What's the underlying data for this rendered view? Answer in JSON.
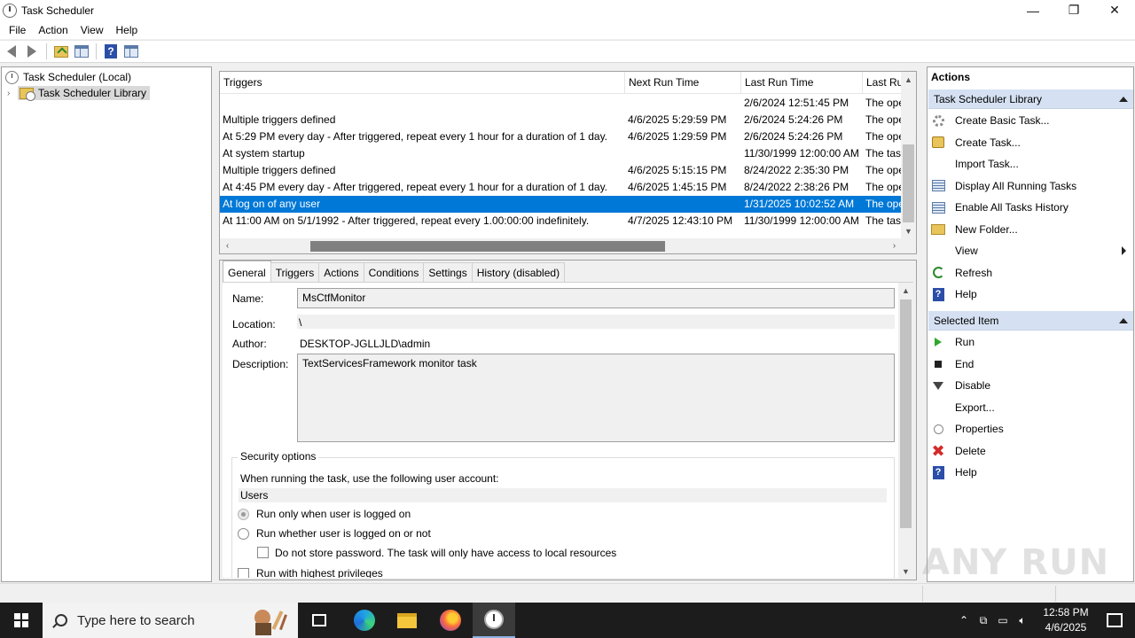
{
  "window": {
    "title": "Task Scheduler",
    "controls": {
      "minimize": "—",
      "restore": "❐",
      "close": "✕"
    }
  },
  "menubar": [
    "File",
    "Action",
    "View",
    "Help"
  ],
  "toolbar": {
    "icons": [
      "back-icon",
      "forward-icon",
      "up-folder-icon",
      "show-hide-console-tree-icon",
      "help-icon",
      "show-hide-action-pane-icon"
    ]
  },
  "tree": {
    "root": "Task Scheduler (Local)",
    "library": "Task Scheduler Library"
  },
  "task_list": {
    "columns": [
      "Triggers",
      "Next Run Time",
      "Last Run Time",
      "Last Ru"
    ],
    "rows": [
      {
        "trigger": "",
        "next": "",
        "last": "2/6/2024 12:51:45 PM",
        "result": "The ope"
      },
      {
        "trigger": "Multiple triggers defined",
        "next": "4/6/2025 5:29:59 PM",
        "last": "2/6/2024 5:24:26 PM",
        "result": "The ope"
      },
      {
        "trigger": "At 5:29 PM every day - After triggered, repeat every 1 hour for a duration of 1 day.",
        "next": "4/6/2025 1:29:59 PM",
        "last": "2/6/2024 5:24:26 PM",
        "result": "The ope"
      },
      {
        "trigger": "At system startup",
        "next": "",
        "last": "11/30/1999 12:00:00 AM",
        "result": "The tas"
      },
      {
        "trigger": "Multiple triggers defined",
        "next": "4/6/2025 5:15:15 PM",
        "last": "8/24/2022 2:35:30 PM",
        "result": "The ope"
      },
      {
        "trigger": "At 4:45 PM every day - After triggered, repeat every 1 hour for a duration of 1 day.",
        "next": "4/6/2025 1:45:15 PM",
        "last": "8/24/2022 2:38:26 PM",
        "result": "The ope"
      },
      {
        "trigger": "At log on of any user",
        "next": "",
        "last": "1/31/2025 10:02:52 AM",
        "result": "The ope",
        "selected": true
      },
      {
        "trigger": "At 11:00 AM on 5/1/1992 - After triggered, repeat every 1.00:00:00 indefinitely.",
        "next": "4/7/2025 12:43:10 PM",
        "last": "11/30/1999 12:00:00 AM",
        "result": "The tas"
      }
    ]
  },
  "details": {
    "tabs": [
      "General",
      "Triggers",
      "Actions",
      "Conditions",
      "Settings",
      "History (disabled)"
    ],
    "active_tab": "General",
    "labels": {
      "name": "Name:",
      "location": "Location:",
      "author": "Author:",
      "description": "Description:"
    },
    "values": {
      "name": "MsCtfMonitor",
      "location": "\\",
      "author": "DESKTOP-JGLLJLD\\admin",
      "description": "TextServicesFramework monitor task"
    },
    "security": {
      "title": "Security options",
      "account_prompt": "When running the task, use the following user account:",
      "account": "Users",
      "radio_logged_on": "Run only when user is logged on",
      "radio_whether": "Run whether user is logged on or not",
      "checkbox_no_store": "Do not store password.  The task will only have access to local resources",
      "checkbox_highest": "Run with highest privileges"
    }
  },
  "actions": {
    "title": "Actions",
    "library_section": "Task Scheduler Library",
    "library_items": [
      {
        "label": "Create Basic Task...",
        "icon": "create-basic-task-icon"
      },
      {
        "label": "Create Task...",
        "icon": "create-task-icon"
      },
      {
        "label": "Import Task...",
        "icon": ""
      },
      {
        "label": "Display All Running Tasks",
        "icon": "running-tasks-icon"
      },
      {
        "label": "Enable All Tasks History",
        "icon": "task-history-icon"
      },
      {
        "label": "New Folder...",
        "icon": "new-folder-icon"
      },
      {
        "label": "View",
        "icon": "",
        "submenu": true
      },
      {
        "label": "Refresh",
        "icon": "refresh-icon"
      },
      {
        "label": "Help",
        "icon": "help-icon"
      }
    ],
    "selected_section": "Selected Item",
    "selected_items": [
      {
        "label": "Run",
        "icon": "run-icon"
      },
      {
        "label": "End",
        "icon": "end-icon"
      },
      {
        "label": "Disable",
        "icon": "disable-icon"
      },
      {
        "label": "Export...",
        "icon": ""
      },
      {
        "label": "Properties",
        "icon": "properties-icon"
      },
      {
        "label": "Delete",
        "icon": "delete-icon"
      },
      {
        "label": "Help",
        "icon": "help-icon"
      }
    ]
  },
  "watermark": "ANY RUN",
  "taskbar": {
    "search_placeholder": "Type here to search",
    "time": "12:58 PM",
    "date": "4/6/2025"
  },
  "colors": {
    "selection": "#0078d7",
    "section_header": "#d5e1f2",
    "taskbar": "#1c1c1c"
  }
}
